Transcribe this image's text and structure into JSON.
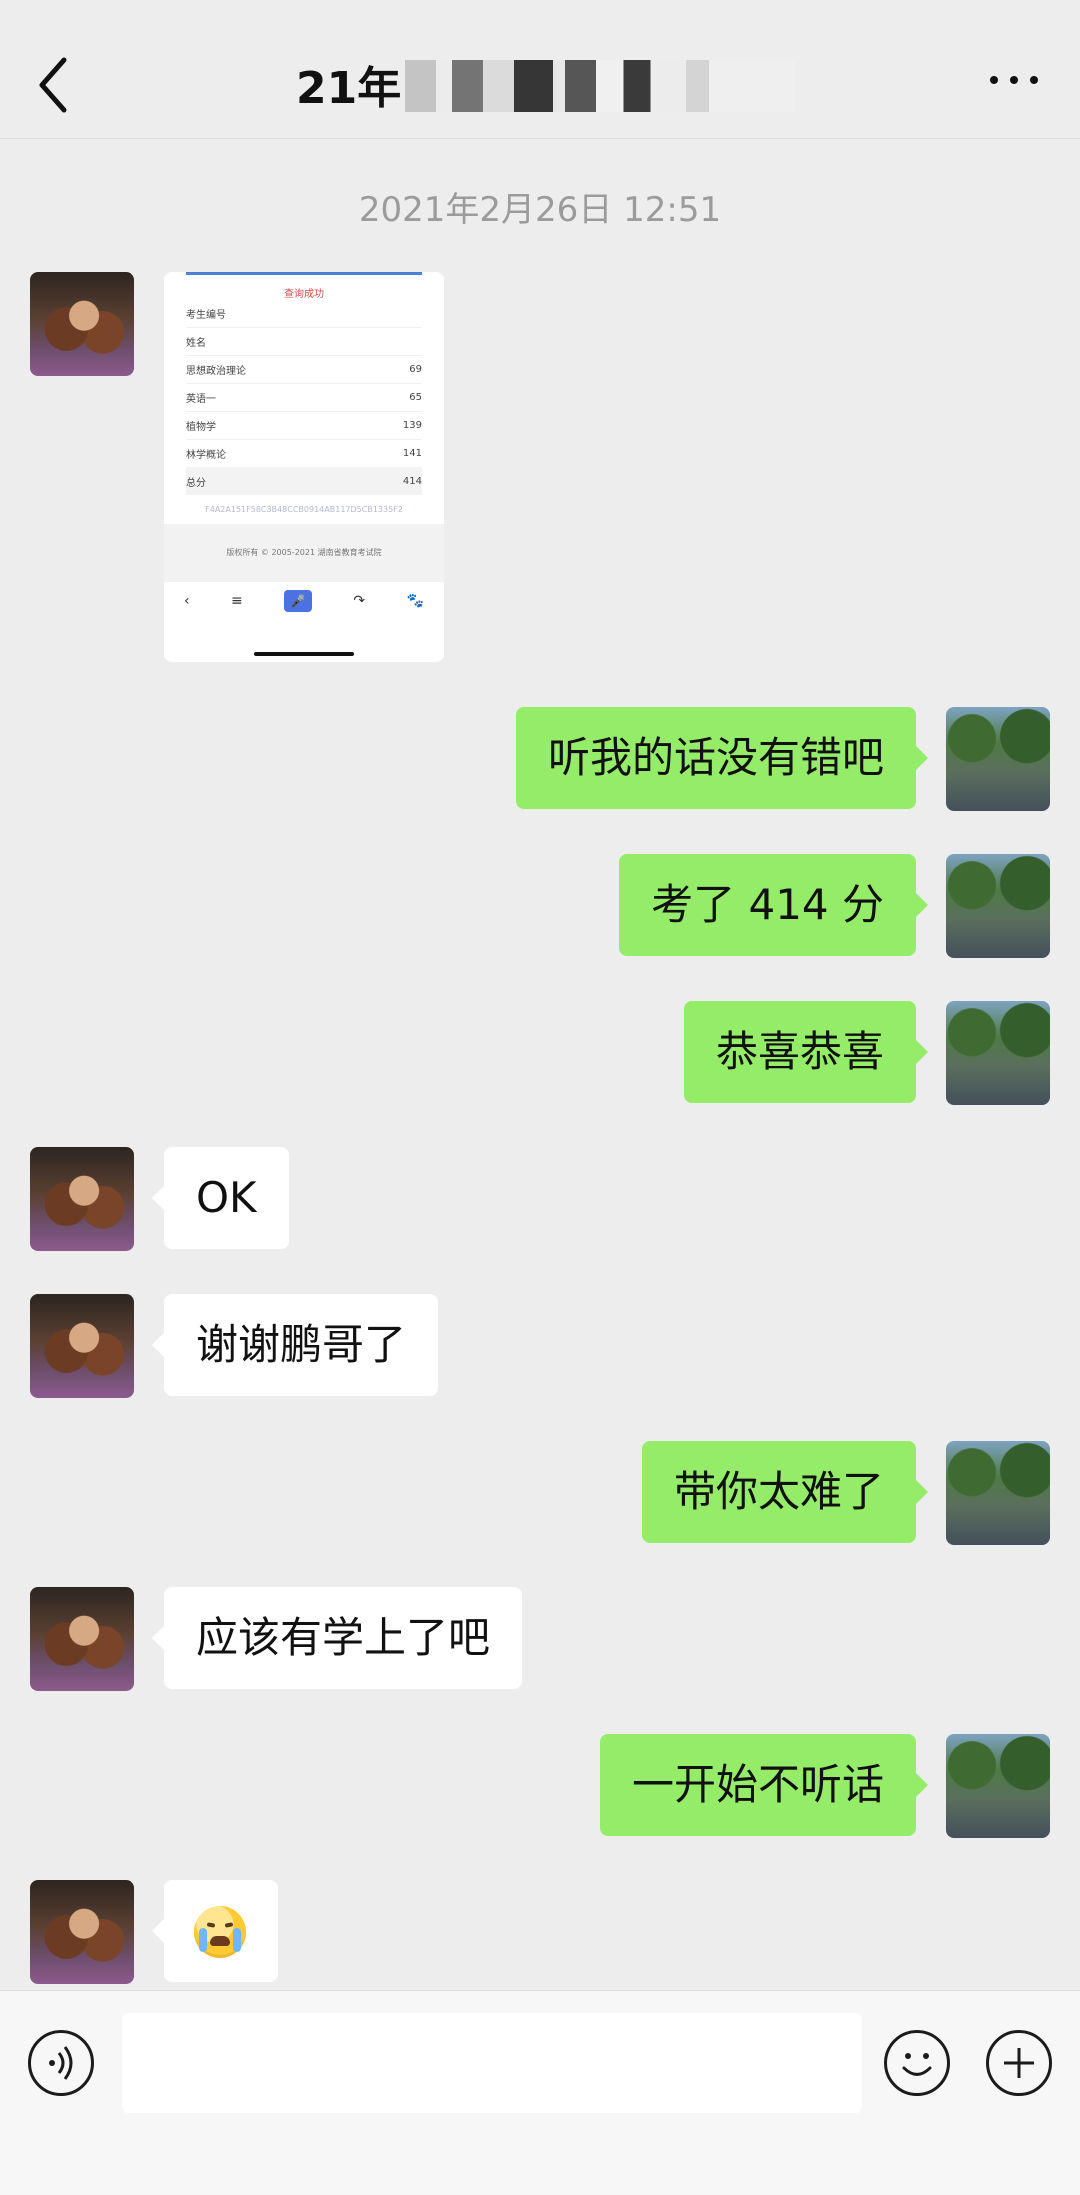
{
  "header": {
    "title": "21年",
    "back_icon": "chevron-left-icon",
    "more_icon": "more-horizontal-icon"
  },
  "chat": {
    "timestamp": "2021年2月26日 12:51",
    "messages": [
      {
        "side": "left",
        "type": "image"
      },
      {
        "side": "right",
        "text": "听我的话没有错吧"
      },
      {
        "side": "right",
        "text": "考了 414 分"
      },
      {
        "side": "right",
        "text": "恭喜恭喜"
      },
      {
        "side": "left",
        "text": "OK"
      },
      {
        "side": "left",
        "text": "谢谢鹏哥了"
      },
      {
        "side": "right",
        "text": "带你太难了"
      },
      {
        "side": "left",
        "text": "应该有学上了吧"
      },
      {
        "side": "right",
        "text": "一开始不听话"
      },
      {
        "side": "left",
        "type": "emoji"
      }
    ]
  },
  "screenshot_card": {
    "caption": "查询成功",
    "rows": [
      {
        "label": "考生编号",
        "value": ""
      },
      {
        "label": "姓名",
        "value": ""
      },
      {
        "label": "思想政治理论",
        "value": "69"
      },
      {
        "label": "英语一",
        "value": "65"
      },
      {
        "label": "植物学",
        "value": "139"
      },
      {
        "label": "林学概论",
        "value": "141"
      },
      {
        "label": "总分",
        "value": "414"
      }
    ],
    "hash": "F4A2A151F58C3B48CCB0914AB117D5CB1335F2",
    "footer": "版权所有 © 2005-2021 湖南省教育考试院"
  },
  "input_bar": {
    "placeholder": "",
    "voice_icon": "voice-icon",
    "emoji_icon": "emoji-icon",
    "plus_icon": "plus-icon"
  }
}
